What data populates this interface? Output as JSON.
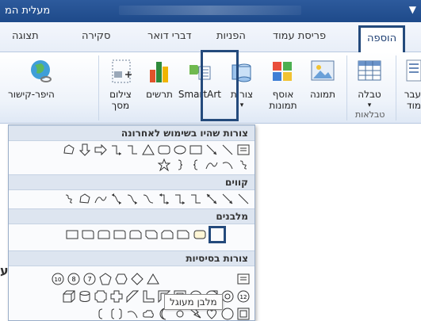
{
  "title_bar": {
    "app_title": "מעלית המ",
    "qat_arrow": "▼"
  },
  "tabs": [
    {
      "label": "הוספה",
      "active": true
    },
    {
      "label": "פריסת עמוד",
      "active": false
    },
    {
      "label": "הפניות",
      "active": false
    },
    {
      "label": "דברי דואר",
      "active": false
    },
    {
      "label": "סקירה",
      "active": false
    },
    {
      "label": "תצוגה",
      "active": false
    }
  ],
  "ribbon": {
    "buttons": {
      "cover_partial": "עבר",
      "cover_partial_2": "מוד",
      "table": "טבלה",
      "picture": "תמונה",
      "clipart": "אוסף",
      "clipart_2": "תמונות",
      "shapes": "צורות",
      "smartart": "SmartArt",
      "chart": "תרשים",
      "screenshot": "צילום",
      "screenshot_2": "מסך",
      "hyperlink": "היפר-קישור"
    },
    "groups": {
      "tables": "טבלאות"
    },
    "dropdown_arrow": "▾"
  },
  "shapes_gallery": {
    "sections": [
      {
        "id": "recent",
        "title": "צורות שהיו בשימוש לאחרונה"
      },
      {
        "id": "lines",
        "title": "קווים"
      },
      {
        "id": "rectangles",
        "title": "מלבנים"
      },
      {
        "id": "basic",
        "title": "צורות בסיסיות"
      }
    ],
    "tooltip": "מלבן מעוגל"
  },
  "document": {
    "left_fragment": "ע"
  },
  "colors": {
    "accent": "#244a7c",
    "title_bar": "#1e4a8a",
    "section_header": "#dde5f0"
  }
}
